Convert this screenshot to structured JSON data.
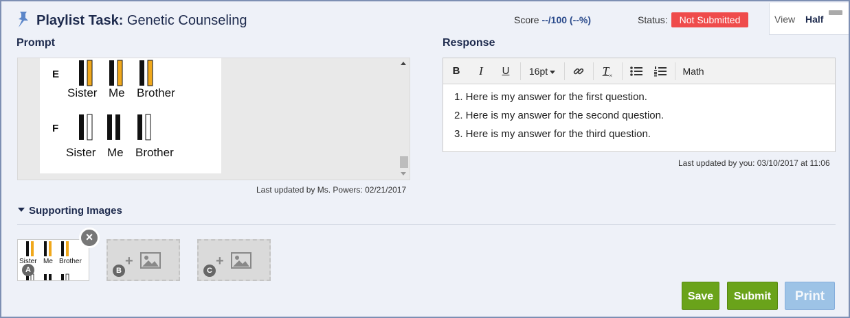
{
  "header": {
    "title_prefix": "Playlist Task:",
    "title_name": "Genetic Counseling",
    "score_label": "Score",
    "score_value": "--/100 (--%)",
    "status_label": "Status:",
    "status_badge": "Not Submitted",
    "view_label": "View",
    "view_value": "Half"
  },
  "prompt": {
    "section_label": "Prompt",
    "rows": [
      {
        "letter": "E",
        "labels": [
          "Sister",
          "Me",
          "Brother"
        ]
      },
      {
        "letter": "F",
        "labels": [
          "Sister",
          "Me",
          "Brother"
        ]
      }
    ],
    "updated_text": "Last updated by Ms. Powers: 02/21/2017"
  },
  "response": {
    "section_label": "Response",
    "toolbar": {
      "bold": "B",
      "italic": "I",
      "underline": "U",
      "font_size": "16pt",
      "math": "Math"
    },
    "lines": [
      "1. Here is my answer for the first question.",
      "2. Here is my answer for the second question.",
      "3. Here is my answer for the third question."
    ],
    "updated_text": "Last updated by you: 03/10/2017 at 11:06"
  },
  "supporting": {
    "toggle_label": "Supporting Images",
    "thumb_labels": [
      "Sister",
      "Me",
      "Brother"
    ],
    "slots": [
      "A",
      "B",
      "C"
    ]
  },
  "buttons": {
    "save": "Save",
    "submit": "Submit",
    "print": "Print"
  },
  "colors": {
    "status_badge": "#ef4b4b",
    "save_submit": "#6aa31a",
    "print": "#9dc3e6",
    "bar_orange": "#f0a81c"
  }
}
